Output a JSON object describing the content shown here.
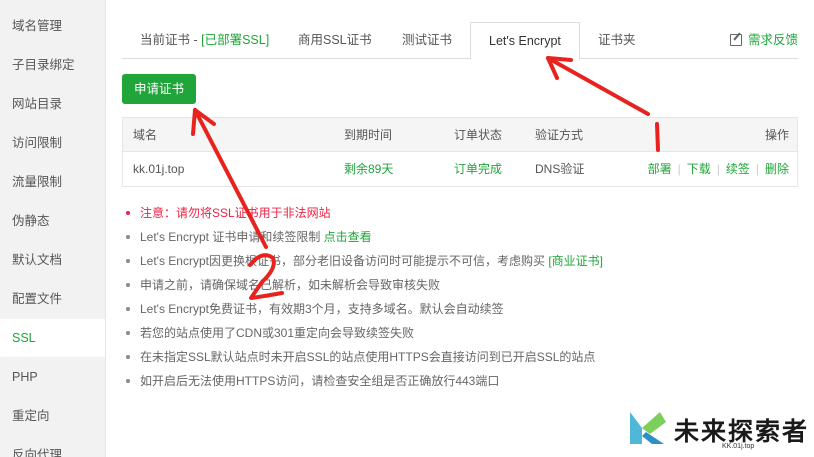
{
  "sidebar": {
    "items": [
      {
        "label": "域名管理"
      },
      {
        "label": "子目录绑定"
      },
      {
        "label": "网站目录"
      },
      {
        "label": "访问限制"
      },
      {
        "label": "流量限制"
      },
      {
        "label": "伪静态"
      },
      {
        "label": "默认文档"
      },
      {
        "label": "配置文件"
      },
      {
        "label": "SSL",
        "active": true
      },
      {
        "label": "PHP"
      },
      {
        "label": "重定向"
      },
      {
        "label": "反向代理"
      }
    ]
  },
  "tabs": {
    "current_prefix": "当前证书 - ",
    "current_status": "[已部署SSL]",
    "commercial": "商用SSL证书",
    "test": "测试证书",
    "letsencrypt": "Let's Encrypt",
    "folder": "证书夹",
    "feedback": "需求反馈"
  },
  "apply_button": "申请证书",
  "table": {
    "headers": {
      "domain": "域名",
      "expire": "到期时间",
      "status": "订单状态",
      "verify": "验证方式",
      "ops": "操作"
    },
    "rows": [
      {
        "domain": "kk.01j.top",
        "expire": "剩余89天",
        "status": "订单完成",
        "verify": "DNS验证",
        "ops": {
          "deploy": "部署",
          "download": "下载",
          "renew": "续签",
          "delete": "删除"
        }
      }
    ]
  },
  "notes": {
    "n1": "注意：请勿将SSL证书用于非法网站",
    "n2_text": "Let's Encrypt 证书申请和续签限制 ",
    "n2_link": "点击查看",
    "n3_text": "Let's Encrypt因更换根证书，部分老旧设备访问时可能提示不可信，考虑购买 ",
    "n3_link": "[商业证书]",
    "n4": "申请之前，请确保域名已解析，如未解析会导致审核失败",
    "n5": "Let's Encrypt免费证书，有效期3个月，支持多域名。默认会自动续签",
    "n6": "若您的站点使用了CDN或301重定向会导致续签失败",
    "n7": "在未指定SSL默认站点时未开启SSL的站点使用HTTPS会直接访问到已开启SSL的站点",
    "n8": "如开启后无法使用HTTPS访问，请检查安全组是否正确放行443端口"
  },
  "annotations": {
    "mark_1": "1",
    "mark_2": "2",
    "color": "#e8231f"
  },
  "watermark": {
    "title": "未来探索者",
    "sub": "KK.01j.top"
  },
  "colors": {
    "accent": "#20a53a",
    "warning": "#e22a2a"
  }
}
